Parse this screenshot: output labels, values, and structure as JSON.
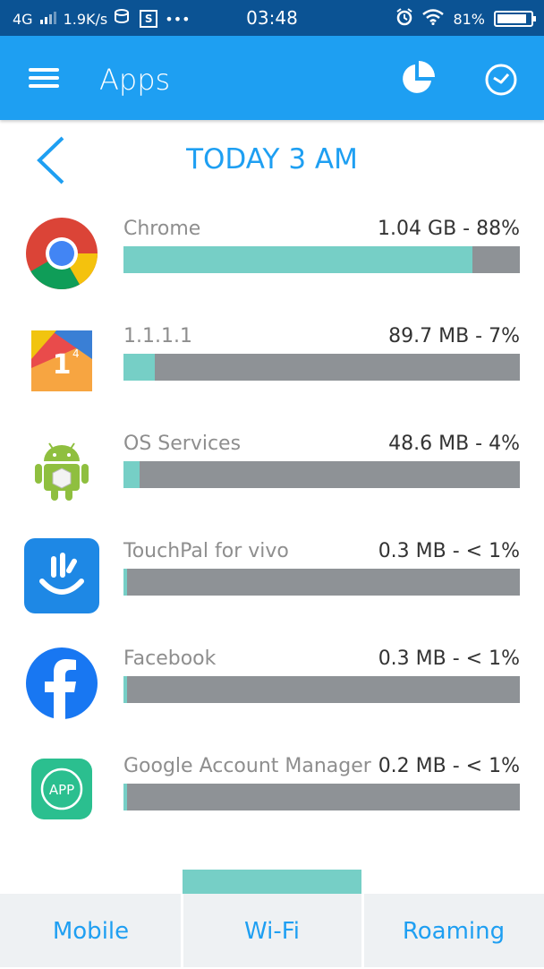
{
  "status_bar": {
    "network": "4G",
    "speed": "1.9K/s",
    "notif_badge": "S",
    "dots": "•••",
    "time": "03:48",
    "battery_percent": "81%"
  },
  "app_bar": {
    "title": "Apps"
  },
  "period": {
    "title": "TODAY 3 AM"
  },
  "apps": [
    {
      "name": "Chrome",
      "usage": "1.04 GB - 88%",
      "fraction": 0.88,
      "icon": "chrome-icon"
    },
    {
      "name": "1.1.1.1",
      "usage": "89.7 MB - 7%",
      "fraction": 0.08,
      "icon": "one-one-one-one-icon"
    },
    {
      "name": "OS Services",
      "usage": "48.6 MB - 4%",
      "fraction": 0.04,
      "icon": "android-icon"
    },
    {
      "name": "TouchPal for vivo",
      "usage": "0.3 MB - < 1%",
      "fraction": 0.01,
      "icon": "touchpal-icon"
    },
    {
      "name": "Facebook",
      "usage": "0.3 MB - < 1%",
      "fraction": 0.01,
      "icon": "facebook-icon"
    },
    {
      "name": "Google Account Manager",
      "usage": "0.2 MB - < 1%",
      "fraction": 0.01,
      "icon": "app-icon",
      "icon_text": "APP"
    }
  ],
  "tabs": [
    {
      "label": "Mobile"
    },
    {
      "label": "Wi-Fi",
      "selected": true
    },
    {
      "label": "Roaming"
    }
  ],
  "colors": {
    "status_bar": "#0b5394",
    "app_bar": "#1e9ff2",
    "accent": "#1e9ff2",
    "bar_fill": "#76cfc6",
    "bar_track": "#8e9296",
    "tabs_bg": "#eef1f3"
  }
}
